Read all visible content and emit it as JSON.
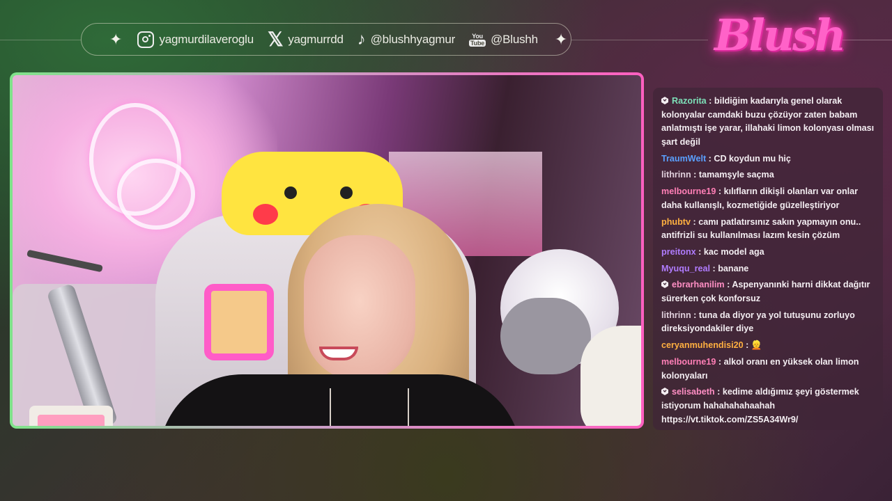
{
  "social_bar": {
    "instagram": "yagmurdilaveroglu",
    "x": "yagmurrdd",
    "tiktok": "@blushhyagmur",
    "youtube_label_top": "You",
    "youtube_label_bottom": "Tube",
    "youtube": "@Blushh"
  },
  "logo_text": "Blush",
  "chat": {
    "messages": [
      {
        "user": "Razorita",
        "color": "#7de0b8",
        "badge": true,
        "text": "bildiğim kadarıyla genel olarak kolonyalar camdaki buzu çözüyor zaten babam anlatmıştı işe yarar, illahaki limon kolonyası olması şart değil"
      },
      {
        "user": "TraumWelt",
        "color": "#5aa0ff",
        "badge": false,
        "text": "CD koydun mu hiç"
      },
      {
        "user": "lithrinn",
        "color": "#e0d0dc",
        "badge": false,
        "text": "tamamşyle saçma"
      },
      {
        "user": "melbourne19",
        "color": "#ff7fb6",
        "badge": false,
        "text": "kılıfların dikişli olanları var onlar daha kullanışlı, kozmetiğide güzelleştiriyor"
      },
      {
        "user": "phubtv",
        "color": "#ffb040",
        "badge": false,
        "text": "camı patlatırsınız sakın yapmayın onu.. antifrizli su kullanılması lazım kesin çözüm"
      },
      {
        "user": "preitonx",
        "color": "#b07cff",
        "badge": false,
        "text": "kac model aga"
      },
      {
        "user": "Myuqu_real",
        "color": "#b07cff",
        "badge": false,
        "text": "banane"
      },
      {
        "user": "ebrarhanilim",
        "color": "#ff8fc4",
        "badge": true,
        "text": "Aspenyanınki harni dikkat dağıtır sürerken çok konforsuz"
      },
      {
        "user": "lithrinn",
        "color": "#e0d0dc",
        "badge": false,
        "text": "tuna da diyor ya yol tutuşunu zorluyo direksiyondakiler diye"
      },
      {
        "user": "ceryanmuhendisi20",
        "color": "#ffb040",
        "badge": false,
        "text": "👱"
      },
      {
        "user": "melbourne19",
        "color": "#ff7fb6",
        "badge": false,
        "text": "alkol oranı en yüksek olan limon kolonyaları"
      },
      {
        "user": "selisabeth",
        "color": "#ff8fc4",
        "badge": true,
        "text": "kedime aldığımız şeyi göstermek istiyorum hahahahahaahah https://vt.tiktok.com/ZS5A34Wr9/"
      }
    ]
  }
}
